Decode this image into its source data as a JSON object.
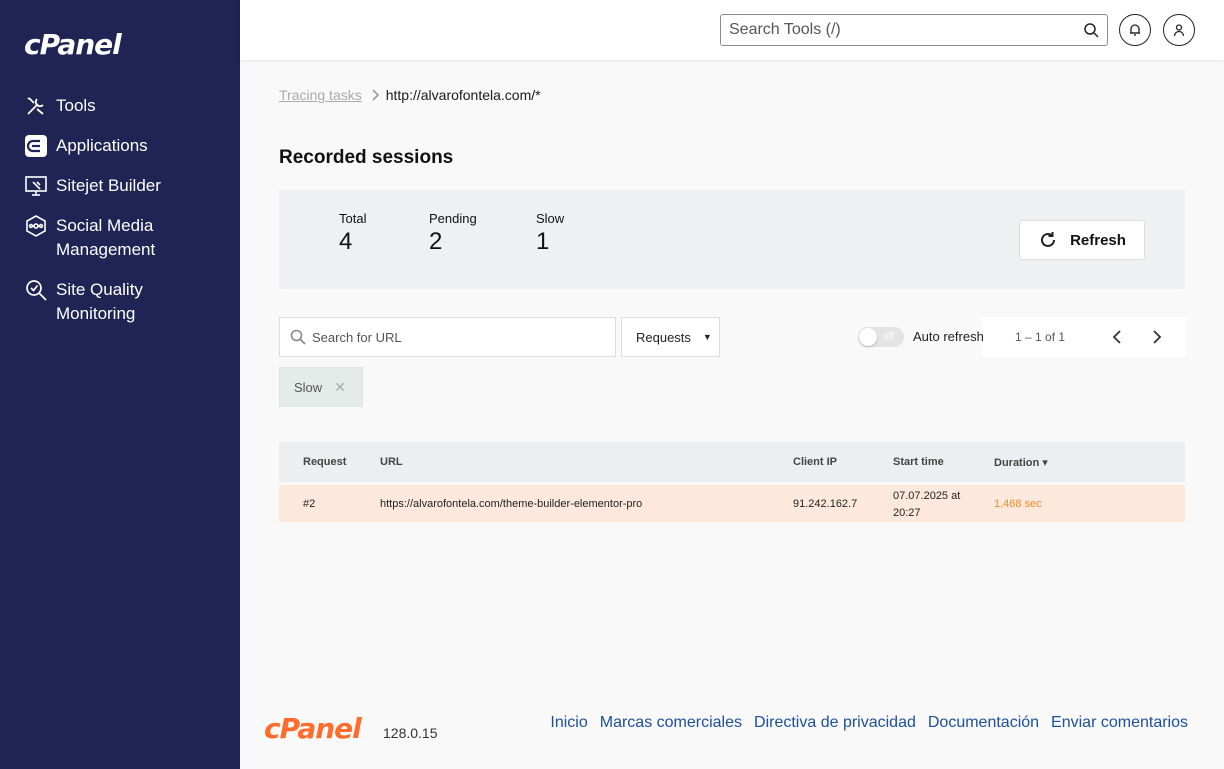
{
  "sidebar": {
    "logo": "cPanel",
    "items": [
      {
        "label": "Tools",
        "icon": "tools-icon"
      },
      {
        "label": "Applications",
        "icon": "applications-icon"
      },
      {
        "label": "Sitejet Builder",
        "icon": "sitejet-icon"
      },
      {
        "label": "Social Media\nManagement",
        "icon": "social-media-icon"
      },
      {
        "label": "Site Quality\nMonitoring",
        "icon": "site-quality-icon"
      }
    ]
  },
  "header": {
    "search_placeholder": "Search Tools (/)"
  },
  "breadcrumb": {
    "parent": "Tracing tasks",
    "current": "http://alvarofontela.com/*"
  },
  "page": {
    "title": "Recorded sessions"
  },
  "stats": {
    "total_label": "Total",
    "total_value": "4",
    "pending_label": "Pending",
    "pending_value": "2",
    "slow_label": "Slow",
    "slow_value": "1",
    "refresh_label": "Refresh"
  },
  "filters": {
    "url_placeholder": "Search for URL",
    "requests_label": "Requests",
    "toggle_state": "off",
    "auto_refresh_label": "Auto refresh",
    "pager_range": "1 – 1 of 1",
    "chip_label": "Slow"
  },
  "table": {
    "headers": [
      "Request",
      "URL",
      "Client IP",
      "Start time",
      "Duration ▾"
    ],
    "rows": [
      {
        "request": "#2",
        "url": "https://alvarofontela.com/theme-builder-elementor-pro",
        "client_ip": "91.242.162.7",
        "start_time": "07.07.2025 at 20:27",
        "duration": "1.468 sec"
      }
    ]
  },
  "footer": {
    "logo": "cPanel",
    "version": "128.0.15",
    "links": [
      "Inicio",
      "Marcas comerciales",
      "Directiva de privacidad",
      "Documentación",
      "Enviar comentarios"
    ]
  },
  "colors": {
    "sidebar_bg": "#1f2455",
    "brand_orange": "#ff6c2c",
    "slow_row": "#fde9db",
    "duration_text": "#f08a30",
    "link": "#1c4f9c"
  }
}
